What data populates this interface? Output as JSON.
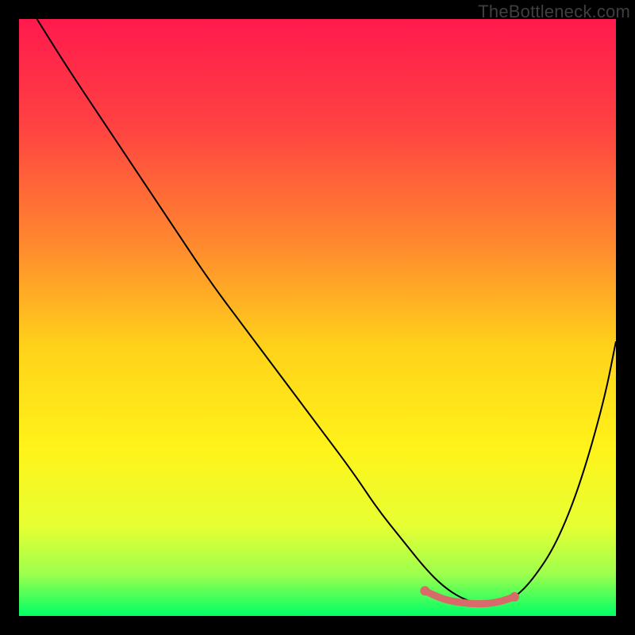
{
  "watermark": "TheBottleneck.com",
  "chart_data": {
    "type": "line",
    "title": "",
    "xlabel": "",
    "ylabel": "",
    "xlim": [
      0,
      100
    ],
    "ylim": [
      0,
      100
    ],
    "grid": false,
    "legend": false,
    "background_gradient": {
      "stops": [
        {
          "offset": 0.0,
          "color": "#ff1a4d"
        },
        {
          "offset": 0.18,
          "color": "#ff4242"
        },
        {
          "offset": 0.38,
          "color": "#ff8a2e"
        },
        {
          "offset": 0.55,
          "color": "#ffd21a"
        },
        {
          "offset": 0.72,
          "color": "#fff31a"
        },
        {
          "offset": 0.85,
          "color": "#e6ff33"
        },
        {
          "offset": 0.93,
          "color": "#9dff4d"
        },
        {
          "offset": 1.0,
          "color": "#00ff66"
        }
      ]
    },
    "series": [
      {
        "name": "curve",
        "color": "#000000",
        "stroke_width": 2,
        "x": [
          3,
          8,
          14,
          20,
          26,
          32,
          38,
          44,
          50,
          56,
          60,
          64,
          68,
          71,
          74,
          77,
          80,
          83,
          86,
          90,
          94,
          98,
          100
        ],
        "y": [
          100,
          92,
          83,
          74,
          65,
          56,
          48,
          40,
          32,
          24,
          18,
          13,
          8,
          5,
          3,
          2,
          2,
          3,
          6,
          12,
          22,
          36,
          46
        ]
      }
    ],
    "highlight": {
      "name": "optimal-range",
      "color": "#d86a6a",
      "stroke_width": 9,
      "x": [
        68,
        71,
        74,
        77,
        80,
        83
      ],
      "y": [
        4.2,
        2.8,
        2.2,
        2.0,
        2.2,
        3.2
      ],
      "endpoints": [
        {
          "x": 68,
          "y": 4.2
        },
        {
          "x": 83,
          "y": 3.2
        }
      ]
    }
  }
}
